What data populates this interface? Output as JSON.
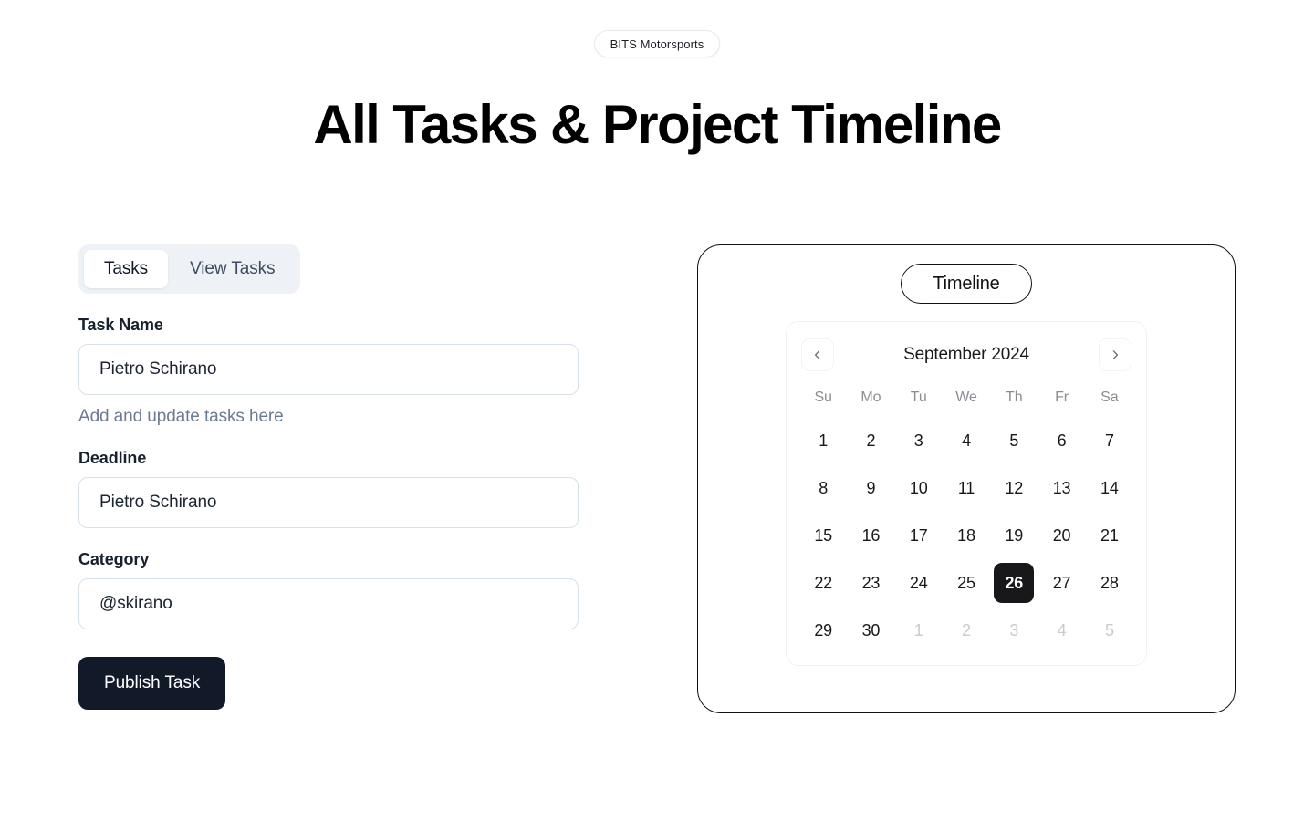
{
  "header": {
    "badge": "BITS Motorsports",
    "title": "All Tasks & Project Timeline"
  },
  "tabs": [
    {
      "label": "Tasks",
      "active": true
    },
    {
      "label": "View Tasks",
      "active": false
    }
  ],
  "form": {
    "task_name": {
      "label": "Task Name",
      "value": "Pietro Schirano",
      "placeholder": "Pietro Schirano",
      "helper": "Add and update tasks here"
    },
    "deadline": {
      "label": "Deadline",
      "value": "Pietro Schirano",
      "placeholder": "Pietro Schirano"
    },
    "category": {
      "label": "Category",
      "value": "@skirano",
      "placeholder": "@skirano"
    },
    "submit_label": "Publish Task"
  },
  "timeline": {
    "pill_label": "Timeline",
    "calendar": {
      "month_label": "September 2024",
      "prev_icon": "chevron-left-icon",
      "next_icon": "chevron-right-icon",
      "weekdays": [
        "Su",
        "Mo",
        "Tu",
        "We",
        "Th",
        "Fr",
        "Sa"
      ],
      "selected_day": 26,
      "weeks": [
        [
          {
            "n": 1,
            "muted": false
          },
          {
            "n": 2,
            "muted": false
          },
          {
            "n": 3,
            "muted": false
          },
          {
            "n": 4,
            "muted": false
          },
          {
            "n": 5,
            "muted": false
          },
          {
            "n": 6,
            "muted": false
          },
          {
            "n": 7,
            "muted": false
          }
        ],
        [
          {
            "n": 8,
            "muted": false
          },
          {
            "n": 9,
            "muted": false
          },
          {
            "n": 10,
            "muted": false
          },
          {
            "n": 11,
            "muted": false
          },
          {
            "n": 12,
            "muted": false
          },
          {
            "n": 13,
            "muted": false
          },
          {
            "n": 14,
            "muted": false
          }
        ],
        [
          {
            "n": 15,
            "muted": false
          },
          {
            "n": 16,
            "muted": false
          },
          {
            "n": 17,
            "muted": false
          },
          {
            "n": 18,
            "muted": false
          },
          {
            "n": 19,
            "muted": false
          },
          {
            "n": 20,
            "muted": false
          },
          {
            "n": 21,
            "muted": false
          }
        ],
        [
          {
            "n": 22,
            "muted": false
          },
          {
            "n": 23,
            "muted": false
          },
          {
            "n": 24,
            "muted": false
          },
          {
            "n": 25,
            "muted": false
          },
          {
            "n": 26,
            "muted": false,
            "selected": true
          },
          {
            "n": 27,
            "muted": false
          },
          {
            "n": 28,
            "muted": false
          }
        ],
        [
          {
            "n": 29,
            "muted": false
          },
          {
            "n": 30,
            "muted": false
          },
          {
            "n": 1,
            "muted": true
          },
          {
            "n": 2,
            "muted": true
          },
          {
            "n": 3,
            "muted": true
          },
          {
            "n": 4,
            "muted": true
          },
          {
            "n": 5,
            "muted": true
          }
        ]
      ]
    }
  },
  "colors": {
    "accent_dark": "#121a2a",
    "selected_day": "#18181b",
    "tab_bg": "#eef1f6",
    "input_border": "#d8e0ea",
    "helper_text": "#6b7b90"
  }
}
